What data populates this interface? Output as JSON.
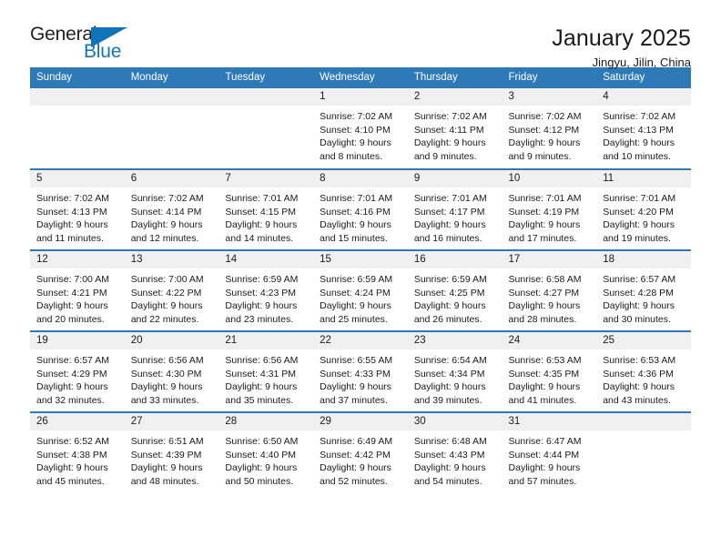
{
  "brand": {
    "name_part1": "General",
    "name_part2": "Blue"
  },
  "header": {
    "title": "January 2025",
    "subtitle": "Jingyu, Jilin, China"
  },
  "calendar": {
    "weekday_headers": [
      "Sunday",
      "Monday",
      "Tuesday",
      "Wednesday",
      "Thursday",
      "Friday",
      "Saturday"
    ],
    "accent_color": "#2e7ab8",
    "daynum_bg": "#f0f0f0",
    "weeks": [
      [
        {
          "day": ""
        },
        {
          "day": ""
        },
        {
          "day": ""
        },
        {
          "day": "1",
          "sunrise": "Sunrise: 7:02 AM",
          "sunset": "Sunset: 4:10 PM",
          "daylight1": "Daylight: 9 hours",
          "daylight2": "and 8 minutes."
        },
        {
          "day": "2",
          "sunrise": "Sunrise: 7:02 AM",
          "sunset": "Sunset: 4:11 PM",
          "daylight1": "Daylight: 9 hours",
          "daylight2": "and 9 minutes."
        },
        {
          "day": "3",
          "sunrise": "Sunrise: 7:02 AM",
          "sunset": "Sunset: 4:12 PM",
          "daylight1": "Daylight: 9 hours",
          "daylight2": "and 9 minutes."
        },
        {
          "day": "4",
          "sunrise": "Sunrise: 7:02 AM",
          "sunset": "Sunset: 4:13 PM",
          "daylight1": "Daylight: 9 hours",
          "daylight2": "and 10 minutes."
        }
      ],
      [
        {
          "day": "5",
          "sunrise": "Sunrise: 7:02 AM",
          "sunset": "Sunset: 4:13 PM",
          "daylight1": "Daylight: 9 hours",
          "daylight2": "and 11 minutes."
        },
        {
          "day": "6",
          "sunrise": "Sunrise: 7:02 AM",
          "sunset": "Sunset: 4:14 PM",
          "daylight1": "Daylight: 9 hours",
          "daylight2": "and 12 minutes."
        },
        {
          "day": "7",
          "sunrise": "Sunrise: 7:01 AM",
          "sunset": "Sunset: 4:15 PM",
          "daylight1": "Daylight: 9 hours",
          "daylight2": "and 14 minutes."
        },
        {
          "day": "8",
          "sunrise": "Sunrise: 7:01 AM",
          "sunset": "Sunset: 4:16 PM",
          "daylight1": "Daylight: 9 hours",
          "daylight2": "and 15 minutes."
        },
        {
          "day": "9",
          "sunrise": "Sunrise: 7:01 AM",
          "sunset": "Sunset: 4:17 PM",
          "daylight1": "Daylight: 9 hours",
          "daylight2": "and 16 minutes."
        },
        {
          "day": "10",
          "sunrise": "Sunrise: 7:01 AM",
          "sunset": "Sunset: 4:19 PM",
          "daylight1": "Daylight: 9 hours",
          "daylight2": "and 17 minutes."
        },
        {
          "day": "11",
          "sunrise": "Sunrise: 7:01 AM",
          "sunset": "Sunset: 4:20 PM",
          "daylight1": "Daylight: 9 hours",
          "daylight2": "and 19 minutes."
        }
      ],
      [
        {
          "day": "12",
          "sunrise": "Sunrise: 7:00 AM",
          "sunset": "Sunset: 4:21 PM",
          "daylight1": "Daylight: 9 hours",
          "daylight2": "and 20 minutes."
        },
        {
          "day": "13",
          "sunrise": "Sunrise: 7:00 AM",
          "sunset": "Sunset: 4:22 PM",
          "daylight1": "Daylight: 9 hours",
          "daylight2": "and 22 minutes."
        },
        {
          "day": "14",
          "sunrise": "Sunrise: 6:59 AM",
          "sunset": "Sunset: 4:23 PM",
          "daylight1": "Daylight: 9 hours",
          "daylight2": "and 23 minutes."
        },
        {
          "day": "15",
          "sunrise": "Sunrise: 6:59 AM",
          "sunset": "Sunset: 4:24 PM",
          "daylight1": "Daylight: 9 hours",
          "daylight2": "and 25 minutes."
        },
        {
          "day": "16",
          "sunrise": "Sunrise: 6:59 AM",
          "sunset": "Sunset: 4:25 PM",
          "daylight1": "Daylight: 9 hours",
          "daylight2": "and 26 minutes."
        },
        {
          "day": "17",
          "sunrise": "Sunrise: 6:58 AM",
          "sunset": "Sunset: 4:27 PM",
          "daylight1": "Daylight: 9 hours",
          "daylight2": "and 28 minutes."
        },
        {
          "day": "18",
          "sunrise": "Sunrise: 6:57 AM",
          "sunset": "Sunset: 4:28 PM",
          "daylight1": "Daylight: 9 hours",
          "daylight2": "and 30 minutes."
        }
      ],
      [
        {
          "day": "19",
          "sunrise": "Sunrise: 6:57 AM",
          "sunset": "Sunset: 4:29 PM",
          "daylight1": "Daylight: 9 hours",
          "daylight2": "and 32 minutes."
        },
        {
          "day": "20",
          "sunrise": "Sunrise: 6:56 AM",
          "sunset": "Sunset: 4:30 PM",
          "daylight1": "Daylight: 9 hours",
          "daylight2": "and 33 minutes."
        },
        {
          "day": "21",
          "sunrise": "Sunrise: 6:56 AM",
          "sunset": "Sunset: 4:31 PM",
          "daylight1": "Daylight: 9 hours",
          "daylight2": "and 35 minutes."
        },
        {
          "day": "22",
          "sunrise": "Sunrise: 6:55 AM",
          "sunset": "Sunset: 4:33 PM",
          "daylight1": "Daylight: 9 hours",
          "daylight2": "and 37 minutes."
        },
        {
          "day": "23",
          "sunrise": "Sunrise: 6:54 AM",
          "sunset": "Sunset: 4:34 PM",
          "daylight1": "Daylight: 9 hours",
          "daylight2": "and 39 minutes."
        },
        {
          "day": "24",
          "sunrise": "Sunrise: 6:53 AM",
          "sunset": "Sunset: 4:35 PM",
          "daylight1": "Daylight: 9 hours",
          "daylight2": "and 41 minutes."
        },
        {
          "day": "25",
          "sunrise": "Sunrise: 6:53 AM",
          "sunset": "Sunset: 4:36 PM",
          "daylight1": "Daylight: 9 hours",
          "daylight2": "and 43 minutes."
        }
      ],
      [
        {
          "day": "26",
          "sunrise": "Sunrise: 6:52 AM",
          "sunset": "Sunset: 4:38 PM",
          "daylight1": "Daylight: 9 hours",
          "daylight2": "and 45 minutes."
        },
        {
          "day": "27",
          "sunrise": "Sunrise: 6:51 AM",
          "sunset": "Sunset: 4:39 PM",
          "daylight1": "Daylight: 9 hours",
          "daylight2": "and 48 minutes."
        },
        {
          "day": "28",
          "sunrise": "Sunrise: 6:50 AM",
          "sunset": "Sunset: 4:40 PM",
          "daylight1": "Daylight: 9 hours",
          "daylight2": "and 50 minutes."
        },
        {
          "day": "29",
          "sunrise": "Sunrise: 6:49 AM",
          "sunset": "Sunset: 4:42 PM",
          "daylight1": "Daylight: 9 hours",
          "daylight2": "and 52 minutes."
        },
        {
          "day": "30",
          "sunrise": "Sunrise: 6:48 AM",
          "sunset": "Sunset: 4:43 PM",
          "daylight1": "Daylight: 9 hours",
          "daylight2": "and 54 minutes."
        },
        {
          "day": "31",
          "sunrise": "Sunrise: 6:47 AM",
          "sunset": "Sunset: 4:44 PM",
          "daylight1": "Daylight: 9 hours",
          "daylight2": "and 57 minutes."
        },
        {
          "day": ""
        }
      ]
    ]
  }
}
